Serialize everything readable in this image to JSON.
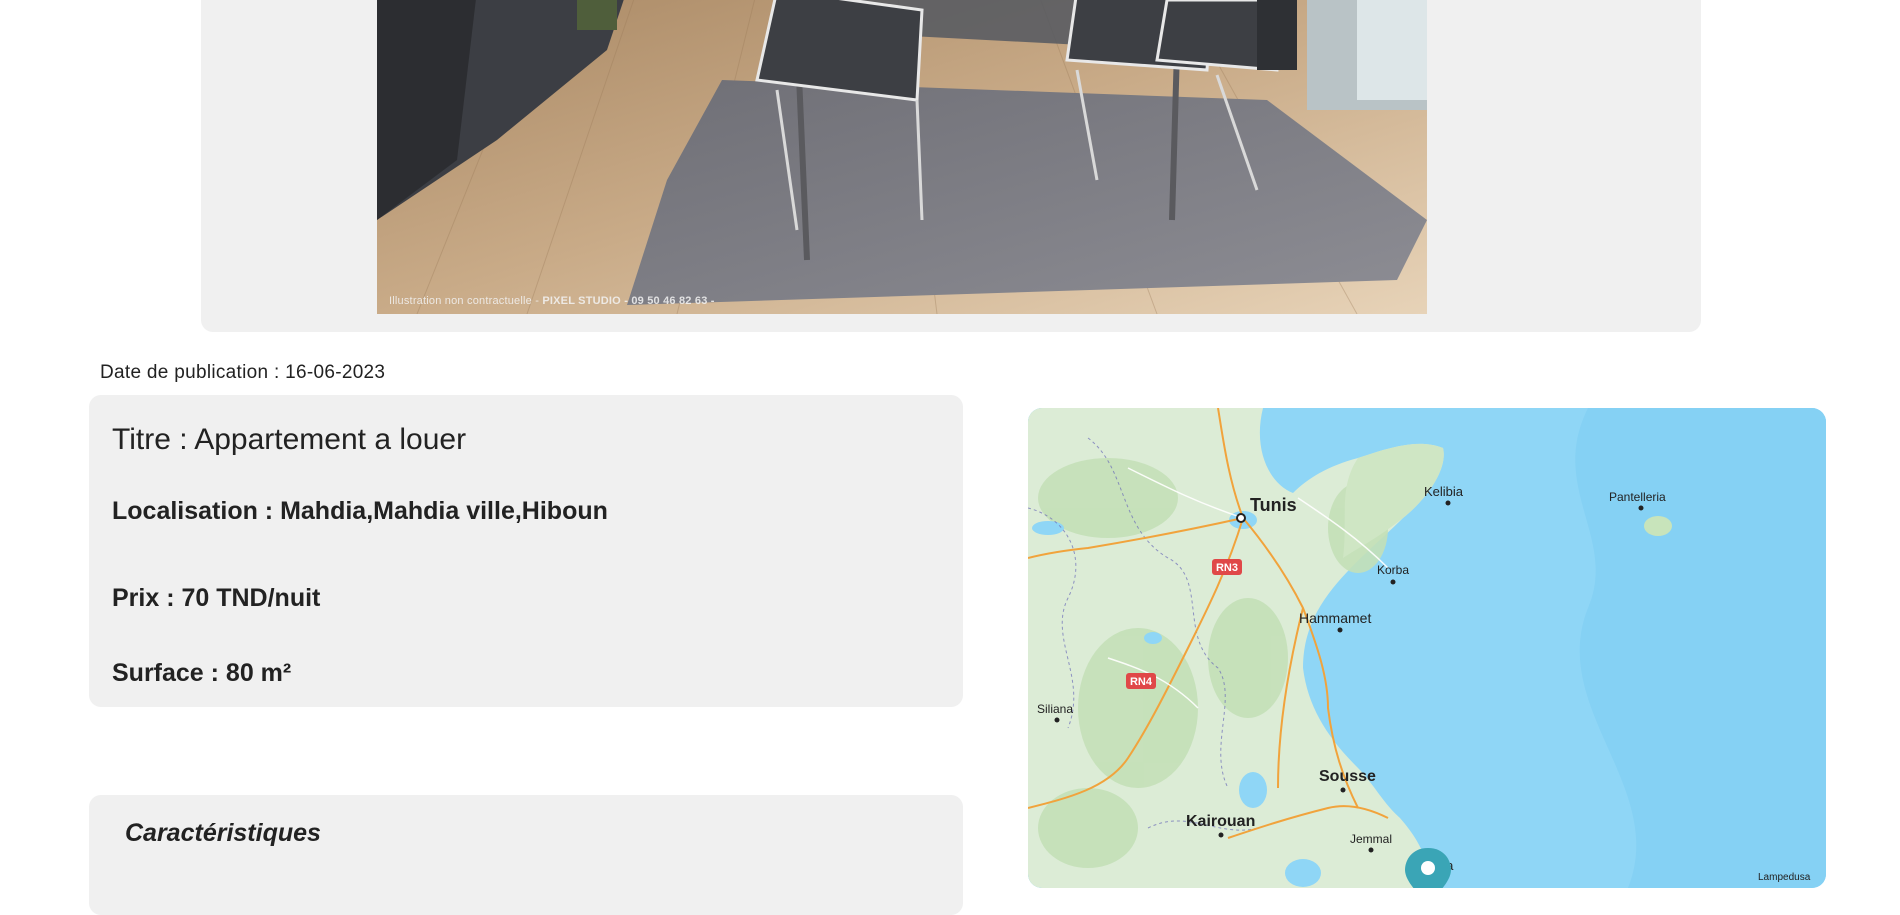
{
  "gallery": {
    "image_alt": "Salle à manger avec table en verre et chaises",
    "watermark_prefix": "Illustration non contractuelle - ",
    "watermark_brand": "PIXEL STUDIO - 09 50 46 82 63 -"
  },
  "listing": {
    "publication_date": "Date de publication : 16-06-2023",
    "title": "Titre : Appartement a louer",
    "location": "Localisation : Mahdia,Mahdia ville,Hiboun",
    "price": "Prix : 70 TND/nuit",
    "surface": "Surface : 80 m²"
  },
  "characteristics": {
    "heading": "Caractéristiques"
  },
  "map": {
    "cities": {
      "tunis": "Tunis",
      "kelibia": "Kelibia",
      "pantelleria": "Pantelleria",
      "korba": "Korba",
      "hammamet": "Hammamet",
      "siliana": "Siliana",
      "sousse": "Sousse",
      "kairouan": "Kairouan",
      "jemmal": "Jemmal",
      "mahdia_partial": "dia",
      "lampedusa_partial": "Lampedusa"
    },
    "roads": {
      "rn3": "RN3",
      "rn4": "RN4"
    },
    "colors": {
      "sea": "#8fd6f6",
      "land": "#dcecd6",
      "road_badge": "#e04848",
      "marker": "#3aa5b6"
    }
  }
}
